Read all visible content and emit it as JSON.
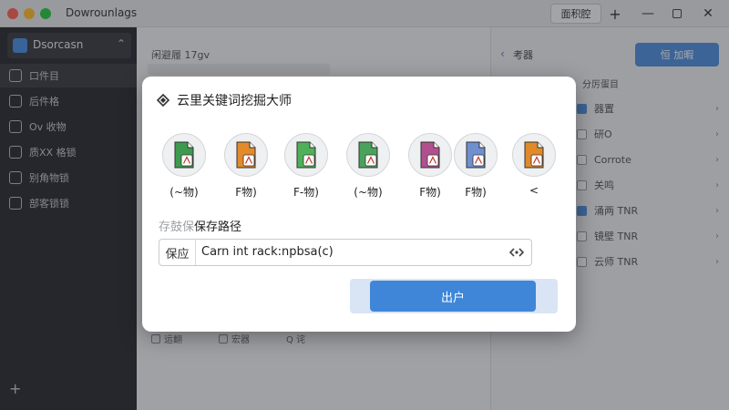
{
  "window": {
    "title": "Dowrounlags",
    "titlebar_label": "面积腔",
    "controls": {
      "plus": "+",
      "minimize": "—",
      "close": "✕"
    }
  },
  "sidebar": {
    "header": "Dsorcasn",
    "items": [
      {
        "label": "口件目"
      },
      {
        "label": "后件格"
      },
      {
        "label": "Ov 收物"
      },
      {
        "label": "质XX 格锁"
      },
      {
        "label": "别角物锁"
      },
      {
        "label": "部客锁锁"
      }
    ],
    "add": "+"
  },
  "middle": {
    "header": "闲避履  17gv",
    "bottom_items": [
      {
        "label": "运翻"
      },
      {
        "label": "宏器"
      },
      {
        "label": "Q 诧"
      }
    ]
  },
  "right_panel": {
    "back": "‹",
    "title": "考器",
    "button": "恒 加暇",
    "subtitle": "分厉蛋目",
    "rows": [
      {
        "label": "器置",
        "checked": true
      },
      {
        "label": "研O",
        "checked": false
      },
      {
        "label": "Corrote",
        "checked": false
      },
      {
        "label": "关鸣",
        "checked": false
      },
      {
        "label": "涌两 TNR",
        "checked": true
      },
      {
        "label": "镜壁 TNR",
        "checked": false
      },
      {
        "label": "云师 TNR",
        "checked": false
      }
    ]
  },
  "dialog": {
    "title": "云里关键词挖掘大师",
    "file_types": [
      {
        "label": "(~物)",
        "color": "#3e9a4f",
        "icon": "file-chart-icon"
      },
      {
        "label": "F物)",
        "color": "#e38a2a",
        "icon": "file-image-icon"
      },
      {
        "label": "F-物)",
        "color": "#4fb05a",
        "icon": "file-image-icon"
      },
      {
        "label": "(~物)",
        "color": "#4aa35a",
        "icon": "file-gear-icon"
      },
      {
        "label": "F物)",
        "color": "#b2508e",
        "icon": "file-image-icon"
      },
      {
        "label": "F物)",
        "color": "#6f8fcf",
        "icon": "file-image-icon"
      },
      {
        "label": "<",
        "color": "#e08a2a",
        "icon": "file-search-icon"
      }
    ],
    "save_label_faint": "存鼓保",
    "save_label": "保存路径",
    "path_prefix": "保应",
    "path_value": "Carn int rack:npbsa(c)",
    "primary_button": "出户"
  }
}
